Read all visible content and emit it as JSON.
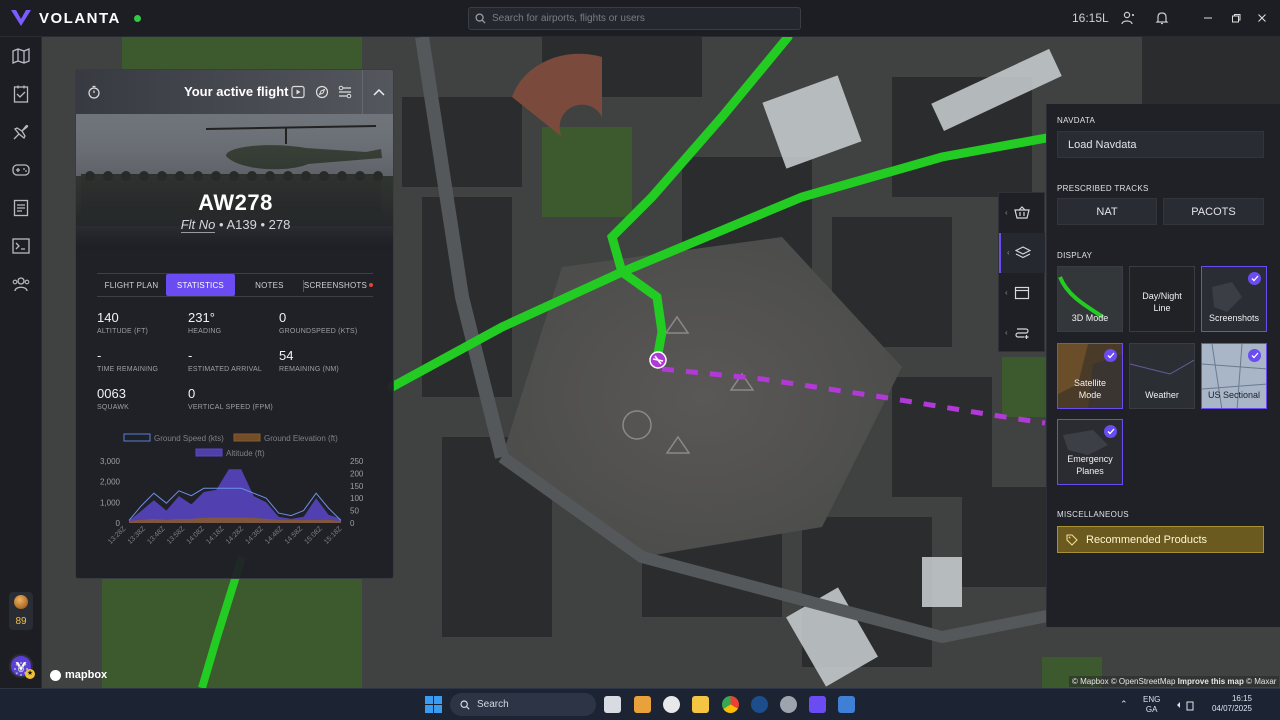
{
  "app": {
    "name": "VOLANTA",
    "status_color": "#2ecc40",
    "accent": "#6a4cf2"
  },
  "search": {
    "placeholder": "Search for airports, flights or users"
  },
  "header": {
    "clock": "16:15L"
  },
  "left_rail": {
    "items": [
      "map-icon",
      "logbook-icon",
      "flights-icon",
      "gamepad-icon",
      "plan-icon",
      "terminal-icon",
      "community-icon"
    ],
    "xp_badge": "89"
  },
  "flight_panel": {
    "title": "Your active flight",
    "callsign": "AW278",
    "flt_no_label": "Flt No",
    "aircraft": "A139",
    "number": "278",
    "tabs": [
      {
        "label": "FLIGHT PLAN",
        "active": false
      },
      {
        "label": "STATISTICS",
        "active": true
      },
      {
        "label": "NOTES",
        "active": false
      },
      {
        "label": "SCREENSHOTS",
        "active": false
      }
    ],
    "stats": [
      {
        "value": "140",
        "label": "ALTITUDE (FT)"
      },
      {
        "value": "231°",
        "label": "HEADING"
      },
      {
        "value": "0",
        "label": "GROUNDSPEED (KTS)"
      },
      {
        "value": "-",
        "label": "TIME REMAINING"
      },
      {
        "value": "-",
        "label": "ESTIMATED ARRIVAL"
      },
      {
        "value": "54",
        "label": "REMAINING (NM)"
      },
      {
        "value": "0063",
        "label": "SQUAWK"
      },
      {
        "value": "0",
        "label": "VERTICAL SPEED (FPM)"
      }
    ]
  },
  "chart_data": {
    "type": "area",
    "legend": [
      "Ground Speed (kts)",
      "Ground Elevation (ft)",
      "Altitude (ft)"
    ],
    "legend_colors": [
      "#5a7fd8",
      "#8a5a2a",
      "#5b47c9"
    ],
    "x": [
      "13:28Z",
      "13:38Z",
      "13:48Z",
      "13:58Z",
      "14:08Z",
      "14:18Z",
      "14:28Z",
      "14:38Z",
      "14:48Z",
      "14:58Z",
      "15:08Z",
      "15:18Z"
    ],
    "y_left_ticks": [
      "3,000",
      "2,000",
      "1,000",
      "0"
    ],
    "y_right_ticks": [
      "250",
      "200",
      "150",
      "100",
      "50",
      "0"
    ],
    "ylim_left": [
      0,
      3000
    ],
    "ylim_right": [
      0,
      250
    ],
    "series": [
      {
        "name": "Altitude (ft)",
        "values": [
          100,
          600,
          1100,
          600,
          1300,
          900,
          1500,
          1600,
          2600,
          2600,
          1300,
          1000,
          300,
          200,
          300,
          1200,
          400,
          200
        ]
      },
      {
        "name": "Ground Speed (kts)",
        "values": [
          10,
          70,
          120,
          80,
          130,
          110,
          140,
          140,
          140,
          140,
          120,
          100,
          40,
          30,
          50,
          120,
          60,
          10
        ]
      },
      {
        "name": "Ground Elevation (ft)",
        "values": [
          100,
          150,
          200,
          150,
          200,
          200,
          250,
          250,
          250,
          250,
          250,
          200,
          150,
          150,
          150,
          150,
          150,
          100
        ]
      }
    ]
  },
  "right_panel": {
    "navdata_title": "NAVDATA",
    "load_navdata": "Load Navdata",
    "tracks_title": "PRESCRIBED TRACKS",
    "tracks": [
      "NAT",
      "PACOTS"
    ],
    "display_title": "DISPLAY",
    "tiles": [
      {
        "label": "3D Mode",
        "on": false
      },
      {
        "label": "Day/Night Line",
        "on": false
      },
      {
        "label": "Screenshots",
        "on": true
      },
      {
        "label": "Satellite Mode",
        "on": true
      },
      {
        "label": "Weather",
        "on": false
      },
      {
        "label": "US Sectional",
        "on": true
      },
      {
        "label": "Emergency Planes",
        "on": true
      }
    ],
    "misc_title": "MISCELLANEOUS",
    "recommended": "Recommended Products"
  },
  "map": {
    "attribution_mapbox": "© Mapbox",
    "attribution_osm": "© OpenStreetMap",
    "attribution_improve": "Improve this map",
    "attribution_maxar": "© Maxar",
    "logo": "mapbox",
    "track_color": "#22cc22",
    "route_color": "#b13ad6"
  },
  "taskbar": {
    "search": "Search",
    "lang_top": "ENG",
    "lang_bottom": "GA",
    "time": "16:15",
    "date": "04/07/2025"
  }
}
